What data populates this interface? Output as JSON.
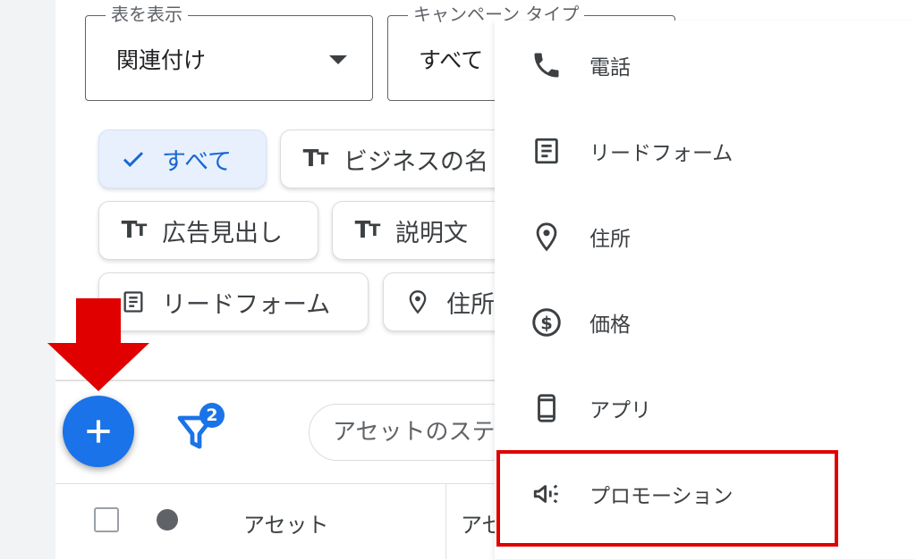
{
  "filters": {
    "view_select": {
      "legend": "表を表示",
      "value": "関連付け"
    },
    "campaign_select": {
      "legend": "キャンペーン タイプ",
      "value": "すべて"
    }
  },
  "chips": {
    "all": "すべて",
    "business_name": "ビジネスの名",
    "headline": "広告見出し",
    "description": "説明文",
    "lead_form": "リードフォーム",
    "location": "住所"
  },
  "toolbar": {
    "filter_badge": "2",
    "search_placeholder": "アセットのステ"
  },
  "table": {
    "columns": [
      "アセット",
      "アセ"
    ]
  },
  "menu": {
    "items": [
      {
        "label": "電話",
        "icon": "phone-icon"
      },
      {
        "label": "リードフォーム",
        "icon": "lead-form-icon"
      },
      {
        "label": "住所",
        "icon": "location-pin-icon"
      },
      {
        "label": "価格",
        "icon": "price-icon"
      },
      {
        "label": "アプリ",
        "icon": "mobile-app-icon"
      },
      {
        "label": "プロモーション",
        "icon": "megaphone-icon"
      }
    ]
  },
  "colors": {
    "primary": "#1a73e8",
    "annotation_red": "#e00000",
    "selected_chip_bg": "#e8f0fe"
  }
}
